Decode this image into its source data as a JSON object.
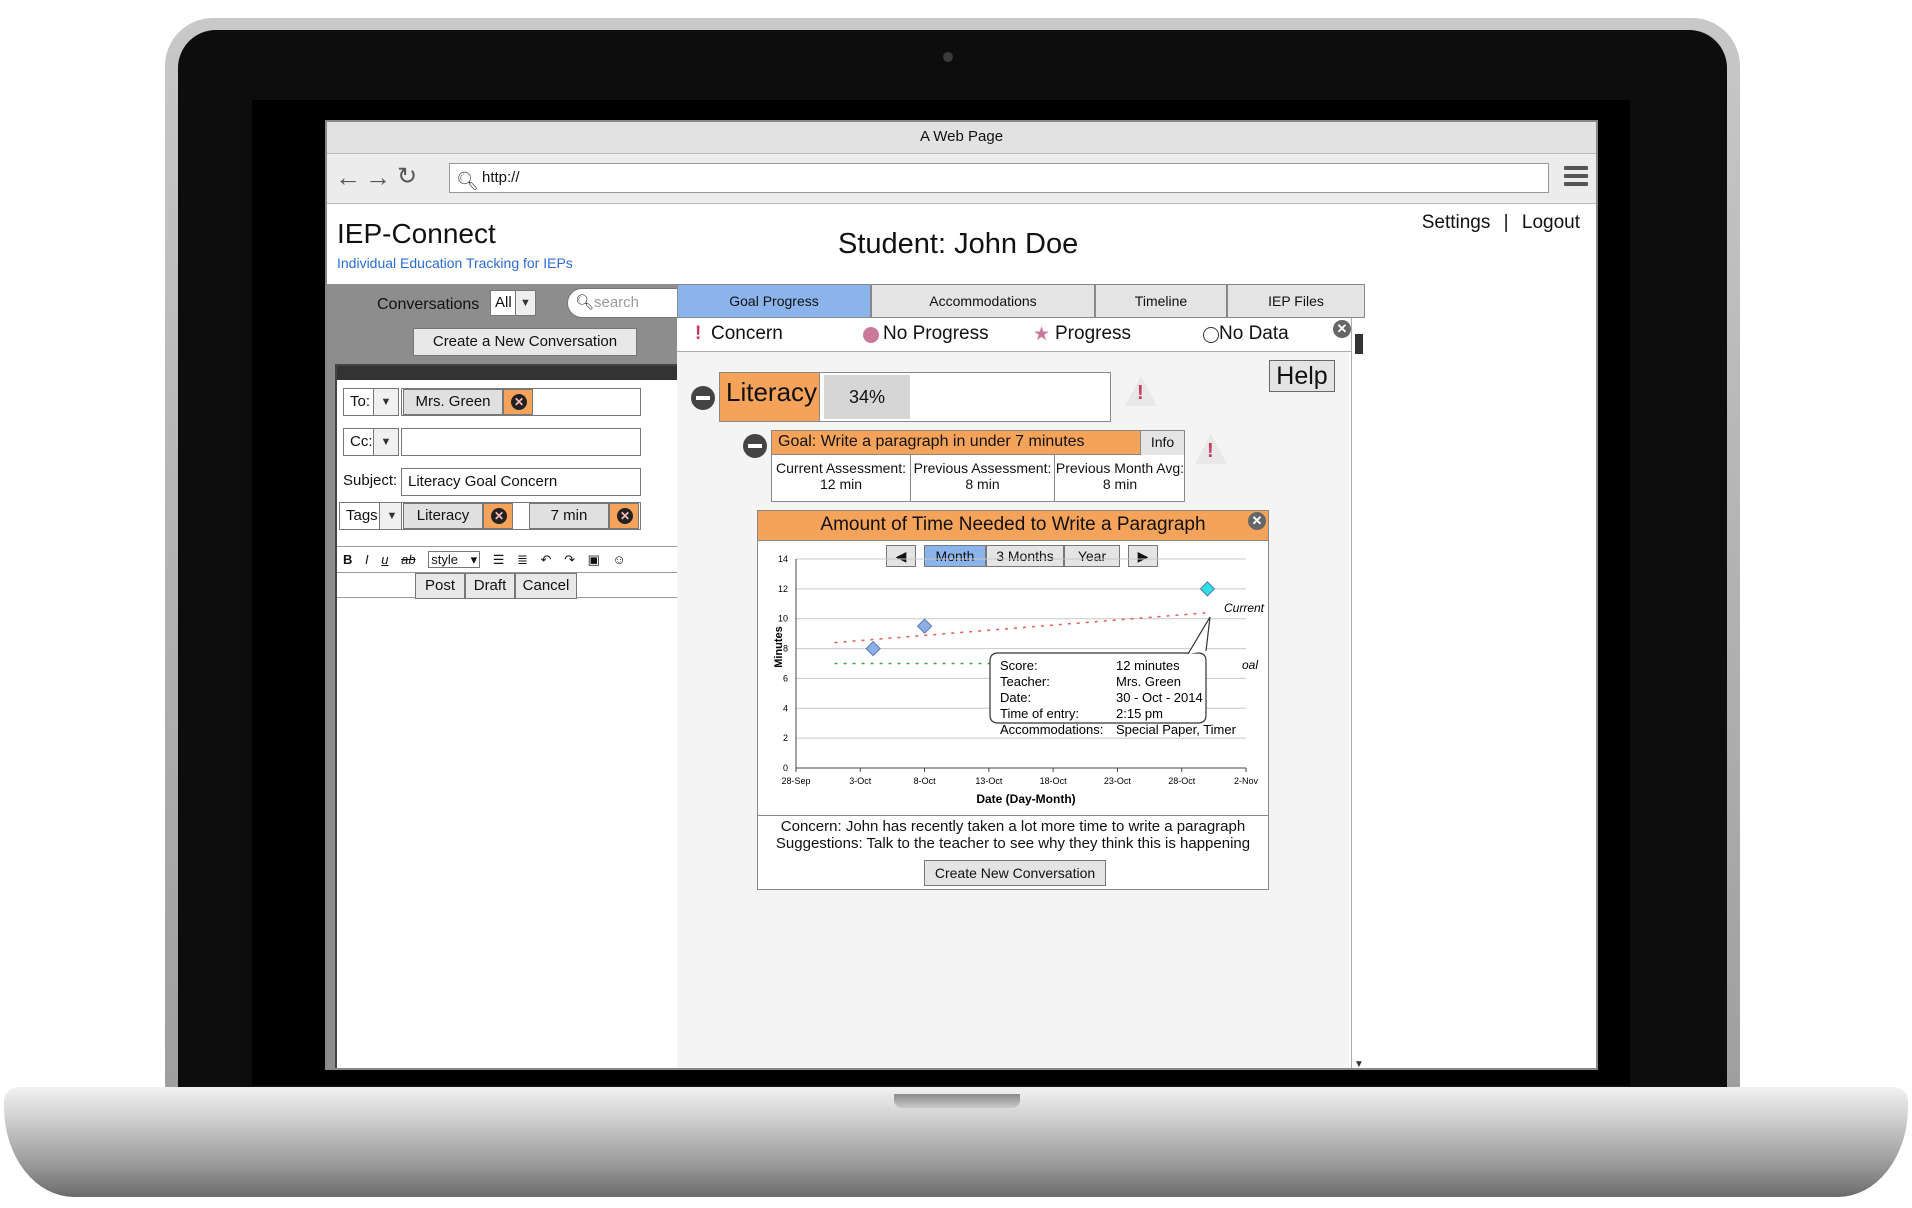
{
  "browser": {
    "window_title": "A Web Page",
    "url": "http://"
  },
  "app": {
    "title": "IEP-Connect",
    "subtitle": "Individual Education Tracking for IEPs",
    "student_heading": "Student: John Doe",
    "links": {
      "settings": "Settings",
      "separator": "|",
      "logout": "Logout"
    }
  },
  "conversations": {
    "label": "Conversations",
    "filter_value": "All",
    "search_placeholder": "search",
    "new_button": "Create a New Conversation",
    "compose": {
      "to_label": "To:",
      "to_recipient": "Mrs. Green",
      "cc_label": "Cc:",
      "cc_value": "",
      "subject_label": "Subject:",
      "subject_value": "Literacy Goal Concern",
      "tags_label": "Tags",
      "tags": [
        "Literacy",
        "7 min"
      ],
      "toolbar": {
        "bold": "B",
        "italic": "I",
        "underline": "u",
        "strike": "ab",
        "style": "style"
      },
      "buttons": {
        "post": "Post",
        "draft": "Draft",
        "cancel": "Cancel"
      }
    }
  },
  "tabs": [
    {
      "label": "Goal Progress",
      "active": true
    },
    {
      "label": "Accommodations",
      "active": false
    },
    {
      "label": "Timeline",
      "active": false
    },
    {
      "label": "IEP Files",
      "active": false
    }
  ],
  "legend": {
    "concern": "Concern",
    "no_progress": "No Progress",
    "progress": "Progress",
    "no_data": "No Data"
  },
  "help_label": "Help",
  "area": {
    "name": "Literacy",
    "percent_label": "34%",
    "percent": 34
  },
  "goal": {
    "title": "Goal: Write a paragraph in under 7 minutes",
    "info_label": "Info",
    "current_label": "Current Assessment:",
    "current_value": "12 min",
    "previous_label": "Previous Assessment:",
    "previous_value": "8 min",
    "prevmonth_label": "Previous Month Avg:",
    "prevmonth_value": "8 min"
  },
  "chart_card": {
    "title": "Amount of Time Needed to Write a Paragraph",
    "ranges": [
      {
        "label": "Month",
        "active": true
      },
      {
        "label": "3 Months",
        "active": false
      },
      {
        "label": "Year",
        "active": false
      }
    ],
    "concern_text": "Concern: John has recently taken a lot more time to write a paragraph",
    "suggestion_text": "Suggestions: Talk to the teacher to see why they think this is happening",
    "new_conv_button": "Create New Conversation",
    "tooltip": {
      "rows": [
        {
          "k": "Score:",
          "v": "12 minutes"
        },
        {
          "k": "Teacher:",
          "v": "Mrs. Green"
        },
        {
          "k": "Date:",
          "v": "30 - Oct - 2014"
        },
        {
          "k": "Time of entry:",
          "v": "2:15 pm"
        },
        {
          "k": "Accommodations:",
          "v": "Special Paper, Timer"
        }
      ]
    },
    "current_label": "Current",
    "goal_label_partial": "oal"
  },
  "chart_data": {
    "type": "scatter",
    "title": "",
    "xlabel": "Date (Day-Month)",
    "ylabel": "Minutes",
    "x_ticks": [
      "28-Sep",
      "3-Oct",
      "8-Oct",
      "13-Oct",
      "18-Oct",
      "23-Oct",
      "28-Oct",
      "2-Nov"
    ],
    "y_ticks": [
      0,
      2,
      4,
      6,
      8,
      10,
      12,
      14
    ],
    "ylim": [
      0,
      14
    ],
    "grid": true,
    "series": [
      {
        "points": [
          {
            "x": "4-Oct",
            "y": 8
          },
          {
            "x": "8-Oct",
            "y": 9.5
          }
        ],
        "color": "#8eaee8"
      },
      {
        "points": [
          {
            "x": "30-Oct",
            "y": 12
          }
        ],
        "color": "#2fe0e6"
      }
    ],
    "trend_line": {
      "color": "#e55a5a",
      "from": {
        "x": "1-Oct",
        "y": 8.4
      },
      "to": {
        "x": "30-Oct",
        "y": 10.4
      }
    },
    "goal_line": {
      "color": "#3aa845",
      "y": 7
    }
  },
  "colors": {
    "accent_orange": "#f5a35a",
    "active_tab": "#8cb4ec",
    "concern": "#c83a62"
  }
}
